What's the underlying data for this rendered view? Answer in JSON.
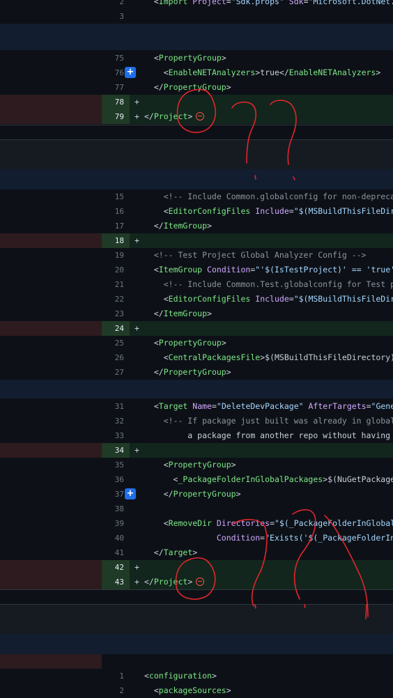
{
  "colors": {
    "added_bg": "#12261d",
    "deleted_bg": "#2d1b1f",
    "hunk_bg": "#121d2f",
    "annotation": "#e0262b",
    "expand_button": "#1f6feb"
  },
  "icons": {
    "expand": "plus-square-icon",
    "no_newline": "minus-circle-icon"
  },
  "expand_glyph": "+",
  "block1": {
    "lines": [
      {
        "num": "2",
        "text": "  <Import Project=\"Sdk.props\" Sdk=\"Microsoft.DotNet.Ar"
      },
      {
        "num": "3",
        "text": ""
      }
    ]
  },
  "block2": {
    "lines": [
      {
        "num": "75",
        "text": "  <PropertyGroup>"
      },
      {
        "num": "76",
        "text": "    <EnableNETAnalyzers>true</EnableNETAnalyzers>"
      },
      {
        "num": "77",
        "text": "  </PropertyGroup>"
      },
      {
        "num": "78",
        "mark": "+",
        "text": ""
      },
      {
        "num": "79",
        "mark": "+",
        "text": "</Project>"
      }
    ]
  },
  "block3": {
    "lines": [
      {
        "num": "15",
        "text": "    <!-- Include Common.globalconfig for non-deprecate"
      },
      {
        "num": "16",
        "text": "    <EditorConfigFiles Include=\"$(MSBuildThisFileDirect"
      },
      {
        "num": "17",
        "text": "  </ItemGroup>"
      },
      {
        "num": "18",
        "mark": "+",
        "text": ""
      },
      {
        "num": "19",
        "text": "  <!-- Test Project Global Analyzer Config -->"
      },
      {
        "num": "20",
        "text": "  <ItemGroup Condition=\"'$(IsTestProject)' == 'true'\">"
      },
      {
        "num": "21",
        "text": "    <!-- Include Common.Test.globalconfig for Test pro"
      },
      {
        "num": "22",
        "text": "    <EditorConfigFiles Include=\"$(MSBuildThisFileDirect"
      },
      {
        "num": "23",
        "text": "  </ItemGroup>"
      },
      {
        "num": "24",
        "mark": "+",
        "text": ""
      },
      {
        "num": "25",
        "text": "  <PropertyGroup>"
      },
      {
        "num": "26",
        "text": "    <CentralPackagesFile>$(MSBuildThisFileDirectory)en"
      },
      {
        "num": "27",
        "text": "  </PropertyGroup>"
      }
    ]
  },
  "block4": {
    "lines": [
      {
        "num": "31",
        "text": "  <Target Name=\"DeleteDevPackage\" AfterTargets=\"Genera"
      },
      {
        "num": "32",
        "text": "    <!-- If package just built was already in global p"
      },
      {
        "num": "33",
        "text": "         a package from another repo without having to"
      },
      {
        "num": "34",
        "mark": "+",
        "text": ""
      },
      {
        "num": "35",
        "text": "    <PropertyGroup>"
      },
      {
        "num": "36",
        "text": "      <_PackageFolderInGlobalPackages>$(NuGetPackageRo"
      },
      {
        "num": "37",
        "text": "    </PropertyGroup>"
      },
      {
        "num": "38",
        "text": ""
      },
      {
        "num": "39",
        "text": "    <RemoveDir Directories=\"$(_PackageFolderInGlobalPa"
      },
      {
        "num": "40",
        "text": "               Condition=\"Exists('$(_PackageFolderInGl"
      },
      {
        "num": "41",
        "text": "  </Target>"
      },
      {
        "num": "42",
        "mark": "+",
        "text": ""
      },
      {
        "num": "43",
        "mark": "+",
        "text": "</Project>"
      }
    ]
  },
  "block5": {
    "lines": [
      {
        "num": "1",
        "text": "<configuration>"
      },
      {
        "num": "2",
        "text": "  <packageSources>"
      }
    ]
  }
}
